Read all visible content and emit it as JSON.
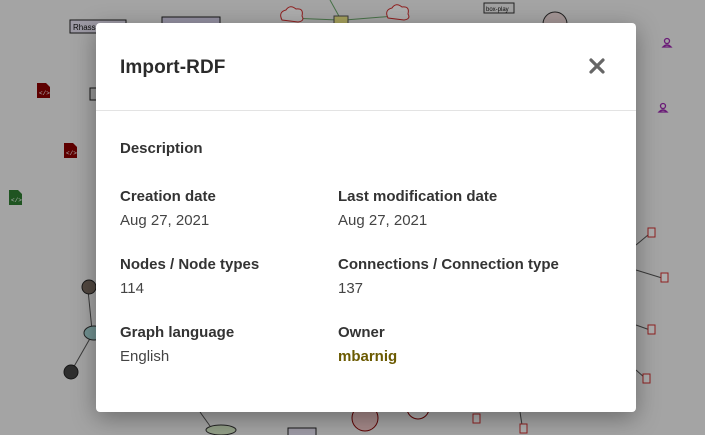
{
  "background": {
    "labels": [
      "Rhass",
      "box-play"
    ],
    "colors": {
      "dark_red": "#8b0000",
      "red": "#d32f2f",
      "green": "#2e7d32",
      "purple": "#9c27b0",
      "yellow": "#f4ec8a",
      "teal": "#a8d8d8"
    }
  },
  "modal": {
    "title": "Import-RDF",
    "close_icon": "close-icon",
    "description_label": "Description",
    "creation_date_label": "Creation date",
    "creation_date_value": "Aug 27, 2021",
    "last_mod_label": "Last modification date",
    "last_mod_value": "Aug 27, 2021",
    "nodes_label": "Nodes / Node types",
    "nodes_value": "114",
    "connections_label": "Connections / Connection type",
    "connections_value": "137",
    "language_label": "Graph language",
    "language_value": "English",
    "owner_label": "Owner",
    "owner_value": "mbarnig"
  }
}
